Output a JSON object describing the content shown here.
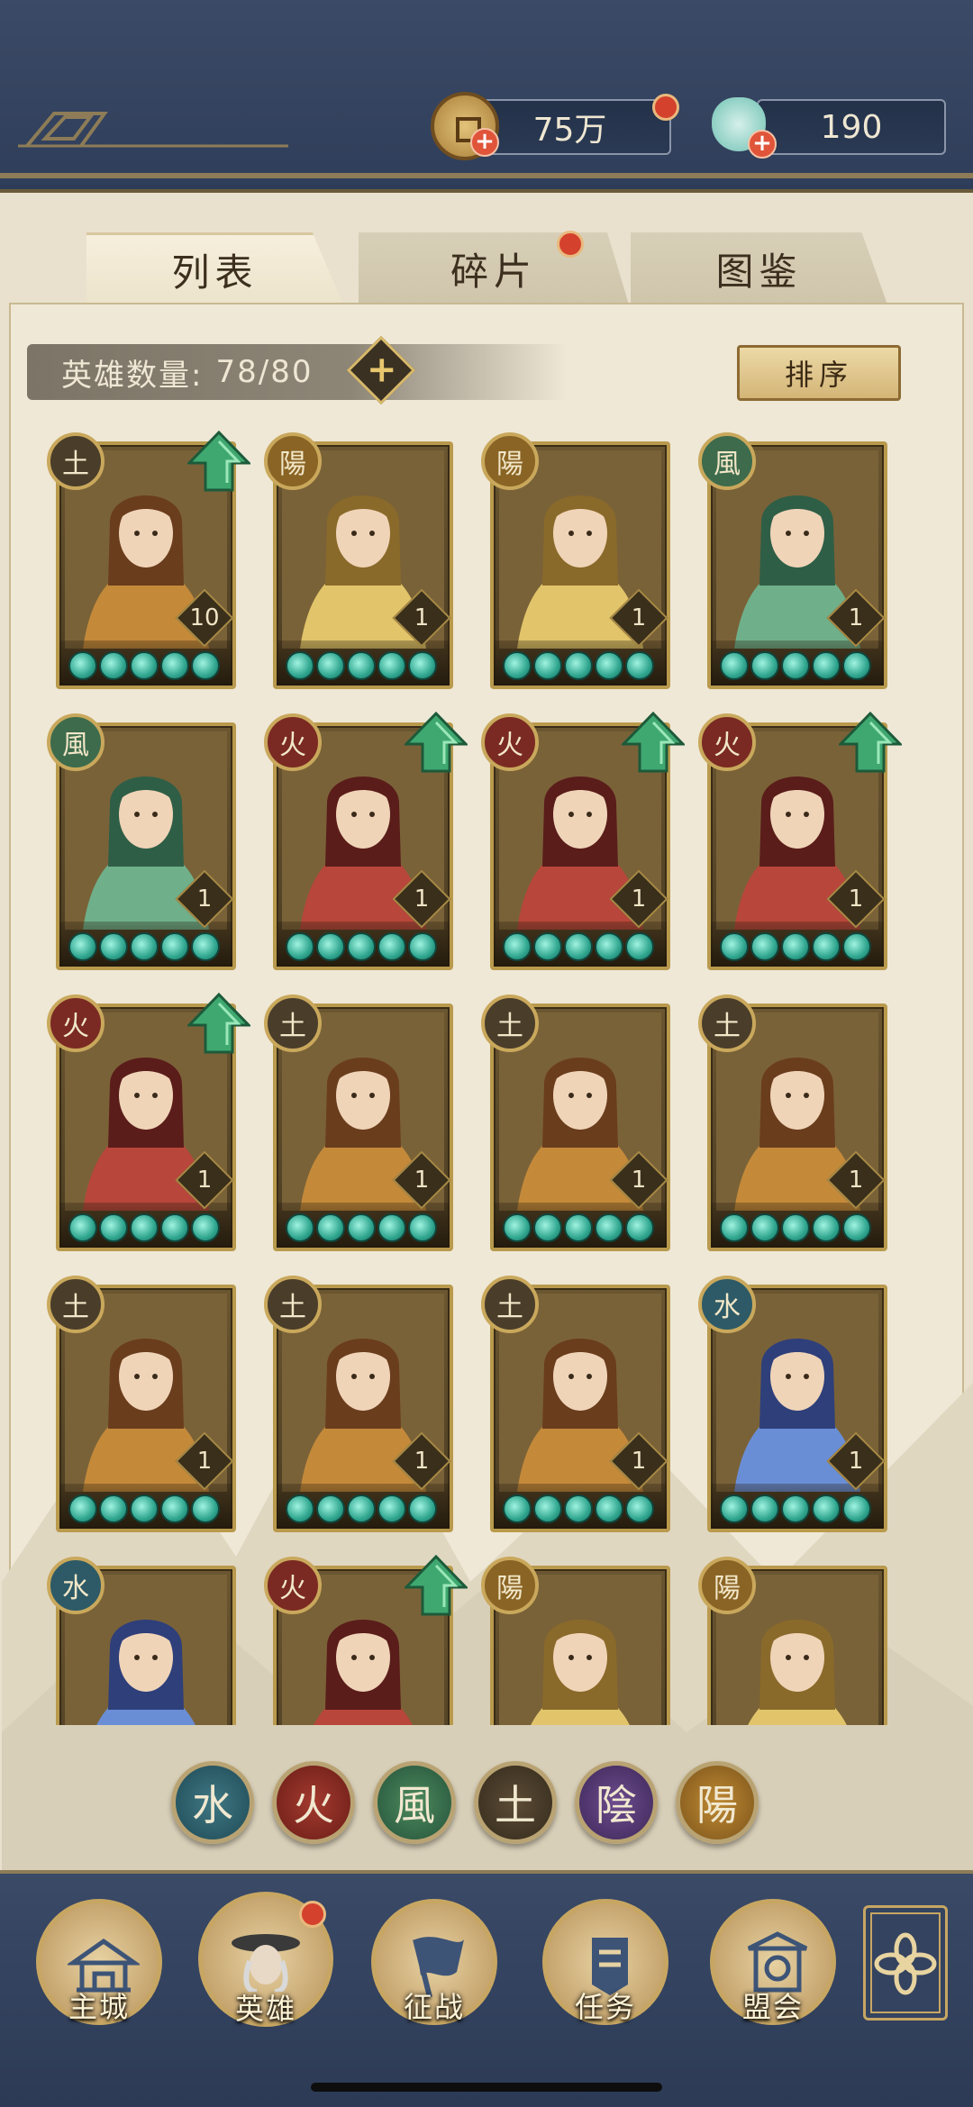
{
  "currency": {
    "coins": "75万",
    "jade": "190"
  },
  "tabs": [
    {
      "label": "列表"
    },
    {
      "label": "碎片"
    },
    {
      "label": "图鉴"
    }
  ],
  "hero_count": {
    "label": "英雄数量:",
    "value": "78/80"
  },
  "sort_label": "排序",
  "heroes": [
    {
      "element": "土",
      "level": "10",
      "upgrade": true
    },
    {
      "element": "陽",
      "level": "1",
      "upgrade": false
    },
    {
      "element": "陽",
      "level": "1",
      "upgrade": false
    },
    {
      "element": "風",
      "level": "1",
      "upgrade": false
    },
    {
      "element": "風",
      "level": "1",
      "upgrade": false
    },
    {
      "element": "火",
      "level": "1",
      "upgrade": true
    },
    {
      "element": "火",
      "level": "1",
      "upgrade": true
    },
    {
      "element": "火",
      "level": "1",
      "upgrade": true
    },
    {
      "element": "火",
      "level": "1",
      "upgrade": true
    },
    {
      "element": "土",
      "level": "1",
      "upgrade": false
    },
    {
      "element": "土",
      "level": "1",
      "upgrade": false
    },
    {
      "element": "土",
      "level": "1",
      "upgrade": false
    },
    {
      "element": "土",
      "level": "1",
      "upgrade": false
    },
    {
      "element": "土",
      "level": "1",
      "upgrade": false
    },
    {
      "element": "土",
      "level": "1",
      "upgrade": false
    },
    {
      "element": "水",
      "level": "1",
      "upgrade": false
    },
    {
      "element": "水",
      "level": "",
      "upgrade": false
    },
    {
      "element": "火",
      "level": "",
      "upgrade": true
    },
    {
      "element": "陽",
      "level": "",
      "upgrade": false
    },
    {
      "element": "陽",
      "level": "",
      "upgrade": false
    }
  ],
  "element_filters": [
    {
      "glyph": "水"
    },
    {
      "glyph": "火"
    },
    {
      "glyph": "風"
    },
    {
      "glyph": "土"
    },
    {
      "glyph": "陰"
    },
    {
      "glyph": "陽"
    }
  ],
  "nav": [
    {
      "label": "主城",
      "icon": "palace-icon"
    },
    {
      "label": "英雄",
      "icon": "hero-portrait-icon"
    },
    {
      "label": "征战",
      "icon": "battle-banner-icon"
    },
    {
      "label": "任务",
      "icon": "quest-scroll-icon"
    },
    {
      "label": "盟会",
      "icon": "guild-hall-icon"
    }
  ],
  "colors": {
    "panel": "#efe8d6",
    "frame_gold": "#b99a4d",
    "nav_blue": "#2f3e5a",
    "badge_red": "#d4412c"
  }
}
